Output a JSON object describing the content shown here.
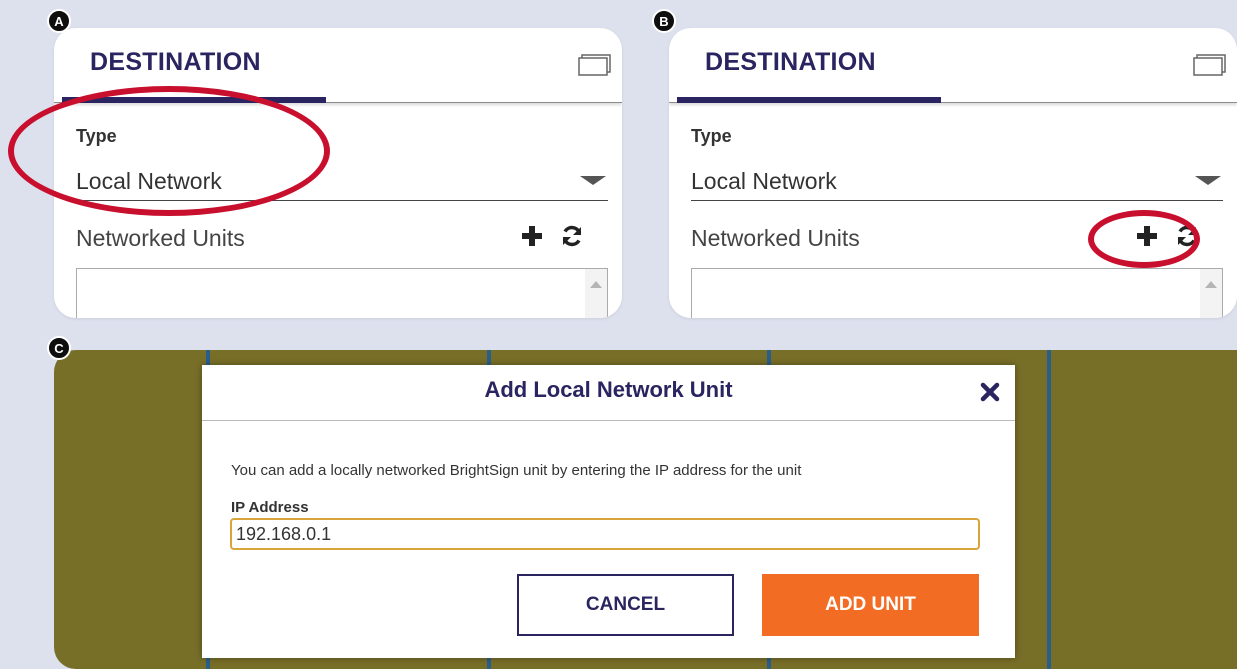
{
  "steps": {
    "a": "A",
    "b": "B",
    "c": "C"
  },
  "panel": {
    "title": "DESTINATION",
    "type_label": "Type",
    "type_value": "Local Network",
    "networked_units_label": "Networked Units",
    "icons": [
      "window-icon",
      "plus-icon",
      "refresh-icon",
      "chevron-down-icon"
    ]
  },
  "dialog": {
    "title": "Add Local Network Unit",
    "description": "You can add a locally networked BrightSign unit by entering the IP address for the unit",
    "ip_label": "IP Address",
    "ip_value": "192.168.0.1",
    "cancel_label": "CANCEL",
    "add_label": "ADD UNIT",
    "icons": [
      "close-icon"
    ]
  },
  "colors": {
    "accent": "#2a2560",
    "highlight_ring": "#c8102e",
    "primary_button": "#f36c23",
    "input_focus": "#d9a43a",
    "backdrop": "#776e28",
    "page_background": "#dde1ee"
  }
}
